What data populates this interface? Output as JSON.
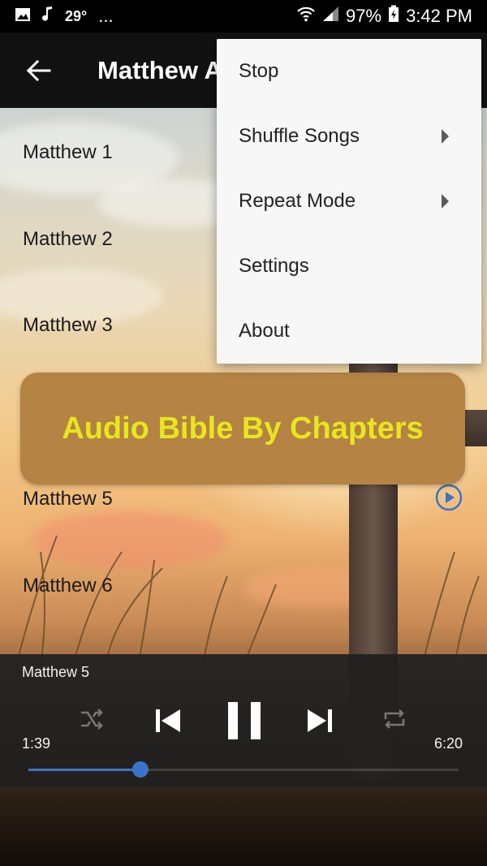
{
  "status_bar": {
    "temperature": "29°",
    "more": "...",
    "battery": "97%",
    "time": "3:42 PM"
  },
  "app_bar": {
    "title": "Matthew A"
  },
  "chapters": [
    "Matthew 1",
    "Matthew 2",
    "Matthew 3",
    "Matthew 5",
    "Matthew 6"
  ],
  "banner": {
    "text": "Audio Bible By Chapters",
    "bg_color": "#b58343",
    "text_color": "#e8e61f"
  },
  "menu": {
    "items": [
      {
        "label": "Stop",
        "submenu": false
      },
      {
        "label": "Shuffle Songs",
        "submenu": true
      },
      {
        "label": "Repeat Mode",
        "submenu": true
      },
      {
        "label": "Settings",
        "submenu": false
      },
      {
        "label": "About",
        "submenu": false
      }
    ]
  },
  "player": {
    "now_playing": "Matthew 5",
    "current_time": "1:39",
    "total_time": "6:20",
    "progress": 0.26,
    "accent": "#3b73c8"
  }
}
